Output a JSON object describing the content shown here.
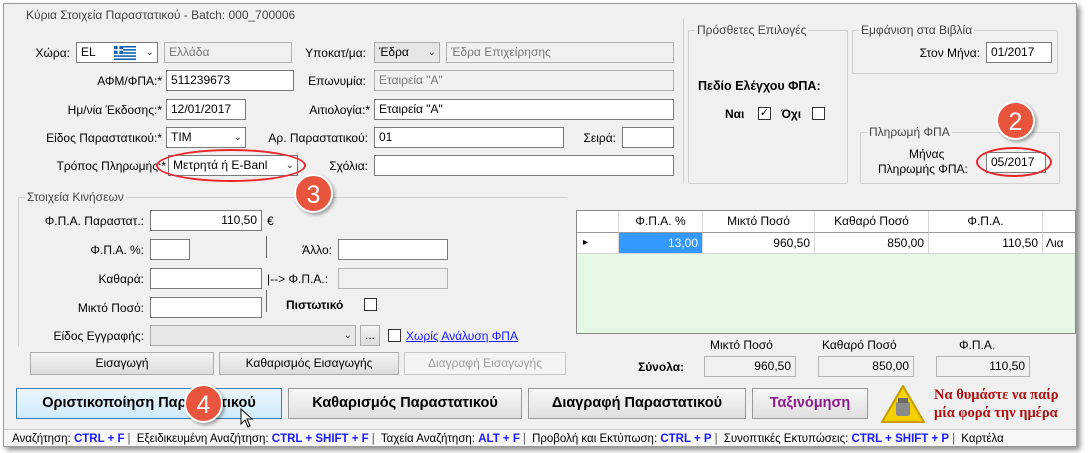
{
  "main_group": {
    "title": "Κύρια Στοιχεία Παραστατικού - Batch: 000_700006",
    "country_label": "Χώρα:",
    "country_code": "EL",
    "country_name": "Ελλάδα",
    "branch_label": "Υποκατ/μα:",
    "branch_code": "Έδρα",
    "branch_name": "Έδρα Επιχείρησης",
    "vat_label": "ΑΦΜ/ΦΠΑ:*",
    "vat_value": "511239673",
    "name_label": "Επωνυμία:",
    "name_value": "Εταιρεία \"Α\"",
    "date_label": "Ημ/νία Έκδοσης:*",
    "date_value": "12/01/2017",
    "reason_label": "Αιτιολογία:*",
    "reason_value": "Εταιρεία \"Α\"",
    "doc_type_label": "Είδος Παραστατικού:*",
    "doc_type_value": "ΤΙΜ",
    "doc_no_label": "Αρ. Παραστατικού:",
    "doc_no_value": "01",
    "series_label": "Σειρά:",
    "series_value": "",
    "payment_label": "Τρόπος Πληρωμής:*",
    "payment_value": "Μετρητά ή E-Banl",
    "comments_label": "Σχόλια:",
    "comments_value": ""
  },
  "extra_group": {
    "title": "Πρόσθετες Επιλογές",
    "vat_check_label": "Πεδίο Ελέγχου ΦΠΑ:",
    "yes_label": "Ναι",
    "yes_checked": true,
    "no_label": "Όχι",
    "no_checked": false
  },
  "books_group": {
    "title": "Εμφάνιση στα Βιβλία",
    "month_label": "Στον Μήνα:",
    "month_value": "01/2017"
  },
  "vat_pay_group": {
    "title": "Πληρωμή ΦΠΑ",
    "month_label_1": "Μήνας",
    "month_label_2": "Πληρωμής ΦΠΑ:",
    "month_value": "05/2017"
  },
  "movements_group": {
    "title": "Στοιχεία Κινήσεων",
    "doc_vat_label": "Φ.Π.Α. Παραστατ.:",
    "doc_vat_value": "110,50",
    "currency_symbol": "€",
    "vat_pct_label": "Φ.Π.Α. %:",
    "vat_pct_value": "",
    "other_label": "Άλλο:",
    "other_value": "",
    "net_label": "Καθαρά:",
    "net_value": "",
    "to_vat_label": "|--> Φ.Π.Α.:",
    "to_vat_value": "",
    "gross_label": "Μικτό Ποσό:",
    "gross_value": "",
    "credit_label": "Πιστωτικό",
    "entry_type_label": "Είδος Εγγραφής:",
    "entry_type_value": "",
    "browse_label": "...",
    "no_vat_analysis_link": "Χωρίς Ανάλυση ΦΠΑ"
  },
  "grid": {
    "columns": [
      "Φ.Π.Α. %",
      "Μικτό Ποσό",
      "Καθαρό Ποσό",
      "Φ.Π.Α.",
      ""
    ],
    "rows": [
      {
        "vat_pct": "13,00",
        "gross": "960,50",
        "net": "850,00",
        "vat": "110,50",
        "extra": "Λια"
      }
    ],
    "row_marker": "▸"
  },
  "totals": {
    "label": "Σύνολα:",
    "gross_label": "Μικτό Ποσό",
    "gross_value": "960,50",
    "net_label": "Καθαρό Ποσό",
    "net_value": "850,00",
    "vat_label": "Φ.Π.Α.",
    "vat_value": "110,50"
  },
  "entry_buttons": {
    "insert": "Εισαγωγή",
    "clear_insert": "Καθαρισμός Εισαγωγής",
    "delete_insert": "Διαγραφή Εισαγωγής"
  },
  "main_buttons": {
    "finalize": "Οριστικοποίηση Παραστατικού",
    "clear_doc": "Καθαρισμός Παραστατικού",
    "delete_doc": "Διαγραφή Παραστατικού",
    "sort": "Ταξινόμηση"
  },
  "reminder": {
    "line1": "Να θυμάστε να παίρ",
    "line2": "μία φορά την ημέρα"
  },
  "badges": {
    "b2": "2",
    "b3": "3",
    "b4": "4"
  },
  "status_bar": {
    "items": [
      {
        "label": "Αναζήτηση:",
        "key": "CTRL + F"
      },
      {
        "label": "Εξειδικευμένη Αναζήτηση:",
        "key": "CTRL + SHIFT + F"
      },
      {
        "label": "Ταχεία Αναζήτηση:",
        "key": "ALT + F"
      },
      {
        "label": "Προβολή και Εκτύπωση:",
        "key": "CTRL + P"
      },
      {
        "label": "Συνοπτικές Εκτυπώσεις:",
        "key": "CTRL + SHIFT + P"
      }
    ],
    "tail": "Καρτέλα"
  },
  "colors": {
    "accent_red": "#e8262b",
    "badge": "#e9553c",
    "grid_selection": "#3399ff",
    "grid_background": "#e5f8e5",
    "link": "#1a1aff",
    "reminder_text": "#b01010",
    "sort_text": "#8b1a8b"
  }
}
